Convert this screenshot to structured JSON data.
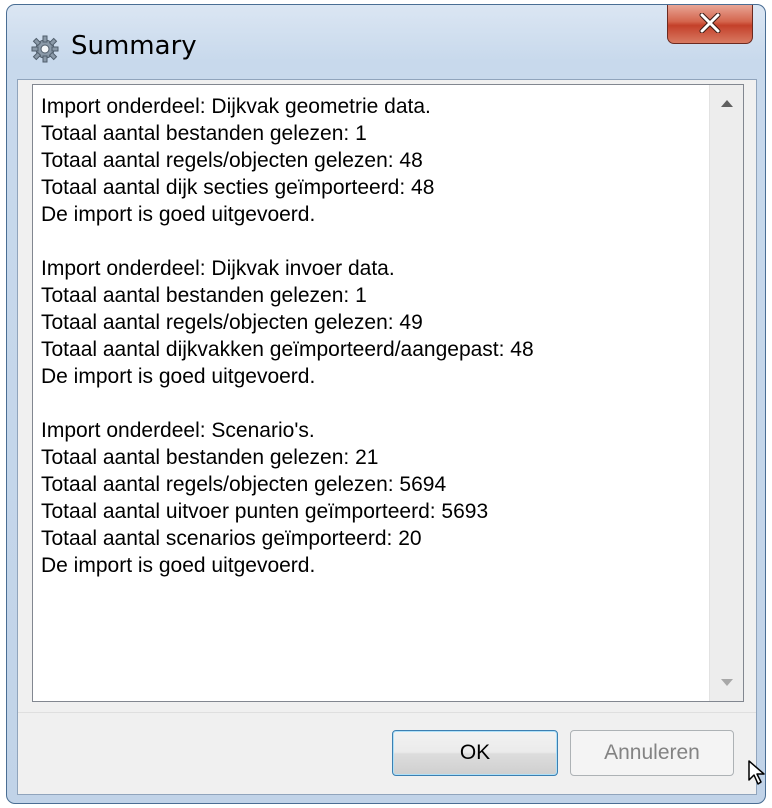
{
  "window": {
    "title": "Summary",
    "title_icon": "gear-icon",
    "close_icon": "close-icon"
  },
  "summary_lines": [
    "Import onderdeel: Dijkvak geometrie data.",
    "Totaal aantal bestanden gelezen: 1",
    "Totaal aantal regels/objecten gelezen: 48",
    "Totaal aantal dijk secties geïmporteerd: 48",
    "De import is goed uitgevoerd.",
    "",
    "Import onderdeel: Dijkvak invoer data.",
    "Totaal aantal bestanden gelezen: 1",
    "Totaal aantal regels/objecten gelezen: 49",
    "Totaal aantal dijkvakken geïmporteerd/aangepast: 48",
    "De import is goed uitgevoerd.",
    "",
    "Import onderdeel: Scenario's.",
    "Totaal aantal bestanden gelezen: 21",
    "Totaal aantal regels/objecten gelezen: 5694",
    "Totaal aantal uitvoer punten geïmporteerd: 5693",
    "Totaal aantal scenarios geïmporteerd: 20",
    "De import is goed uitgevoerd."
  ],
  "buttons": {
    "ok": "OK",
    "cancel": "Annuleren"
  },
  "colors": {
    "close_button": "#c4402a",
    "ok_border": "#3c7fb1",
    "disabled_text": "#838383"
  }
}
